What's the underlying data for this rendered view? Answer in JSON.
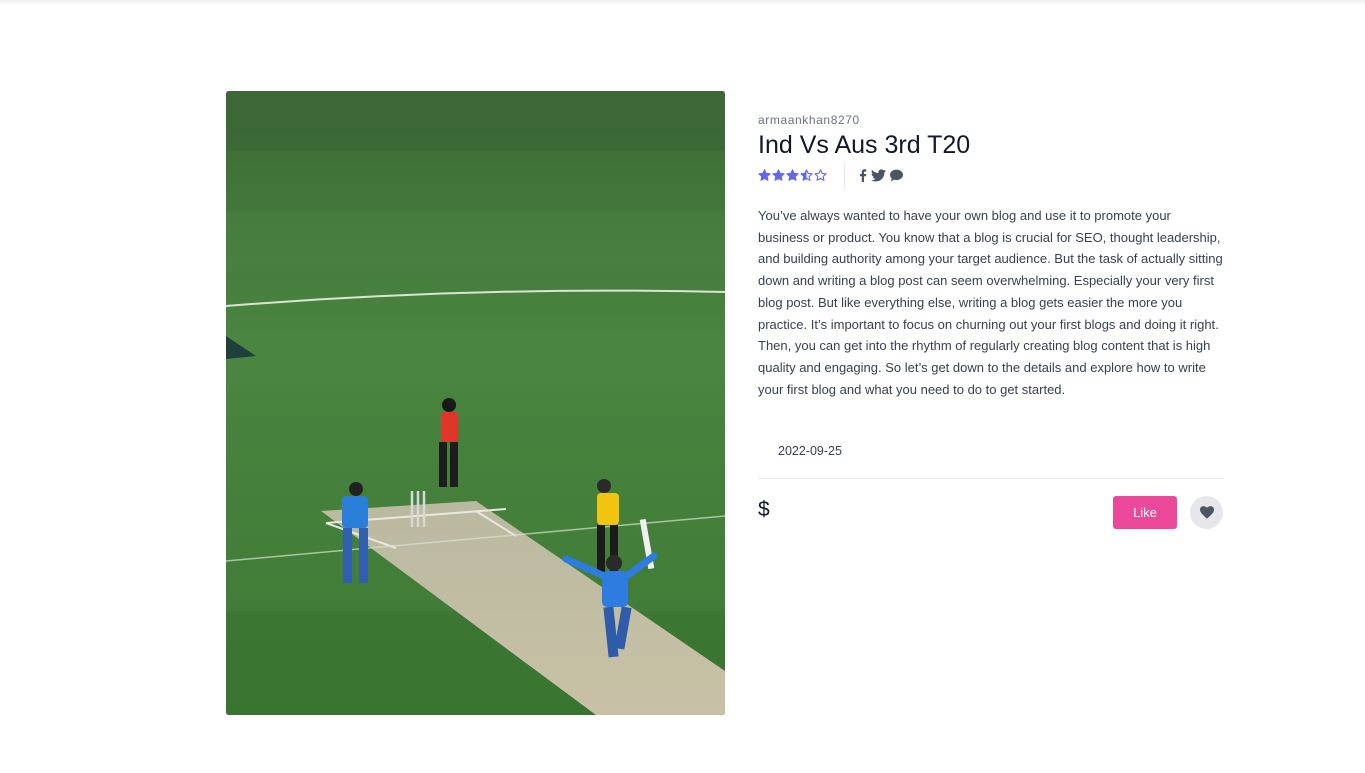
{
  "post": {
    "image_alt": "Cricket match photo",
    "author": "armaankhan8270",
    "title": "Ind Vs Aus 3rd T20",
    "rating": 3.5,
    "rating_max": 5,
    "description": "You’ve always wanted to have your own blog and use it to promote your business or product. You know that a blog is crucial for SEO, thought leadership, and building authority among your target audience. But the task of actually sitting down and writing a blog post can seem overwhelming. Especially your very first blog post. But like everything else, writing a blog gets easier the more you practice. It’s important to focus on churning out your first blogs and doing it right. Then, you can get into the rhythm of regularly creating blog content that is high quality and engaging. So let’s get down to the details and explore how to write your first blog and what you need to do to get started.",
    "date": "2022-09-25",
    "price": "$",
    "like_label": "Like"
  },
  "share": {
    "icons": [
      "facebook-icon",
      "twitter-icon",
      "comment-icon"
    ]
  },
  "colors": {
    "accent": "#ec4899",
    "star": "#6366f1",
    "icon": "#4b5563"
  }
}
